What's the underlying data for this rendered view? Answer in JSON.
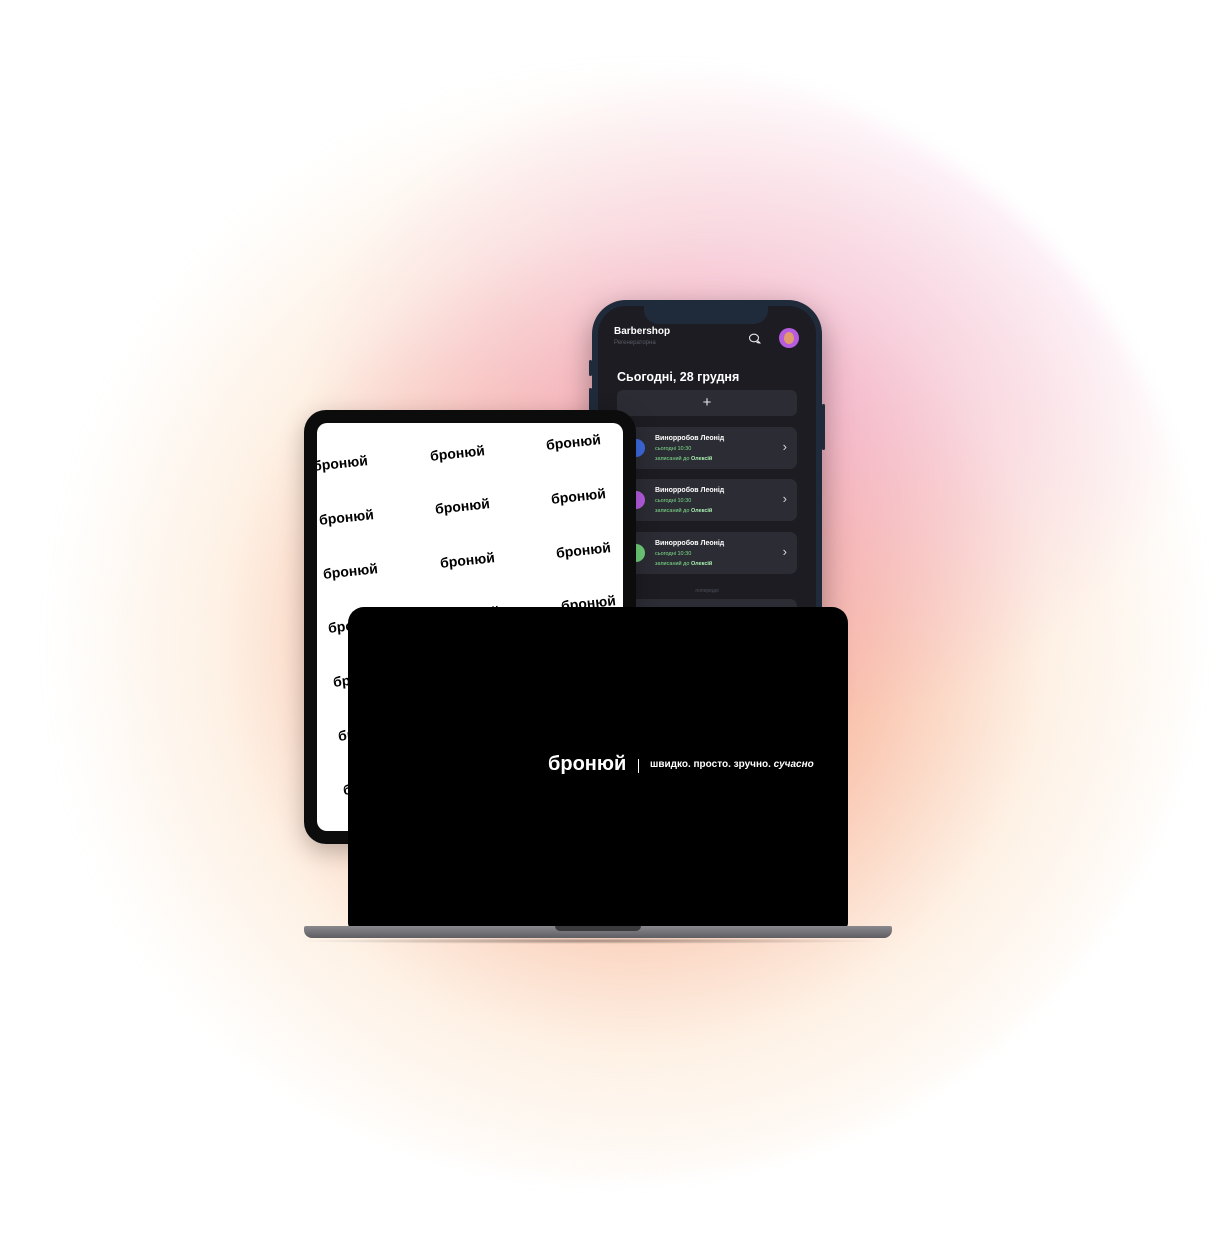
{
  "phone": {
    "business_name": "Barbershop",
    "role": "Регенераторна",
    "date_heading": "Сьогодні, 28 грудня",
    "add_label": "+",
    "earlier_label": "попередні",
    "appointments": [
      {
        "name": "Винорробов Леонід",
        "time": "сьогодні 10:30",
        "to_prefix": "записаний до",
        "master": "Олексій",
        "avatar_color": "#3d6ae0"
      },
      {
        "name": "Винорробов Леонід",
        "time": "сьогодні 10:30",
        "to_prefix": "записаний до",
        "master": "Олексій",
        "avatar_color": "#b65ce0"
      },
      {
        "name": "Винорробов Леонід",
        "time": "сьогодні 10:30",
        "to_prefix": "записаний до",
        "master": "Олексій",
        "avatar_color": "#6fd07a"
      }
    ],
    "chat_icon": "chat-bubbles-icon",
    "chevron_icon": "chevron-right-icon",
    "chevron_glyph": "›"
  },
  "tablet": {
    "watermark": "бронюй"
  },
  "laptop": {
    "brand": "бронюй",
    "slogan_plain": "швидко. просто. зручно.",
    "slogan_italic": "сучасно"
  },
  "colors": {
    "accent_green": "#7fe08a",
    "screen_dark": "#1c1c22",
    "card": "#2c2c35"
  }
}
